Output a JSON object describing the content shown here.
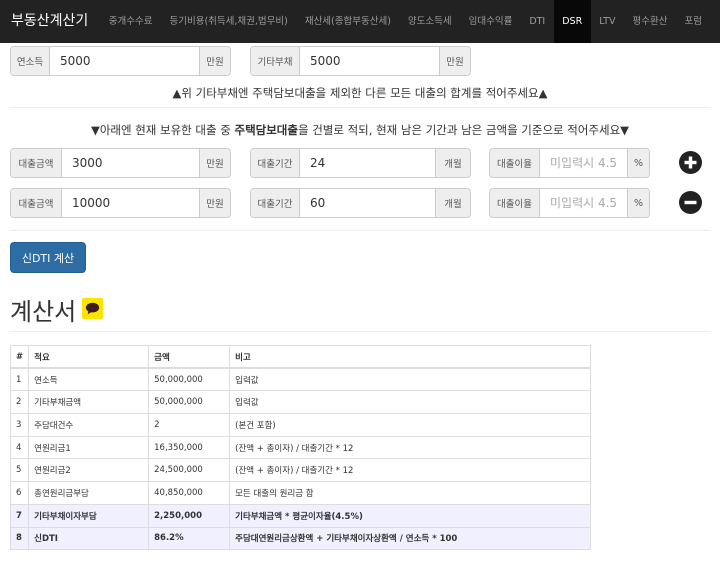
{
  "nav": {
    "brand": "부동산계산기",
    "items": [
      {
        "label": "중개수수료",
        "active": false
      },
      {
        "label": "등기비용(취득세,채권,법무비)",
        "active": false
      },
      {
        "label": "재산세(종합부동산세)",
        "active": false
      },
      {
        "label": "양도소득세",
        "active": false
      },
      {
        "label": "임대수익률",
        "active": false
      },
      {
        "label": "DTI",
        "active": false
      },
      {
        "label": "DSR",
        "active": true
      },
      {
        "label": "LTV",
        "active": false
      },
      {
        "label": "평수환산",
        "active": false
      },
      {
        "label": "포럼",
        "active": false
      }
    ]
  },
  "income": {
    "label": "연소득",
    "value": "5000",
    "unit": "만원"
  },
  "other_debt": {
    "label": "기타부채",
    "value": "5000",
    "unit": "만원"
  },
  "notice1": "▲위 기타부채엔 주택담보대출을 제외한 다른 모든 대출의 합계를 적어주세요▲",
  "notice2": {
    "before": "▼아래엔 현재 보유한 대출 중 ",
    "bold": "주택담보대출",
    "after": "을 건별로 적되, 현재 남은 기간과 남은 금액을 기준으로 적어주세요▼"
  },
  "loans": [
    {
      "amount_label": "대출금액",
      "amount": "3000",
      "amount_unit": "만원",
      "period_label": "대출기간",
      "period": "24",
      "period_unit": "개월",
      "rate_label": "대출이율",
      "rate_value": "",
      "rate_placeholder": "미입력시 4.5",
      "rate_unit": "%",
      "action": "add"
    },
    {
      "amount_label": "대출금액",
      "amount": "10000",
      "amount_unit": "만원",
      "period_label": "대출기간",
      "period": "60",
      "period_unit": "개월",
      "rate_label": "대출이율",
      "rate_value": "",
      "rate_placeholder": "미입력시 4.5",
      "rate_unit": "%",
      "action": "remove"
    }
  ],
  "calc_button": "신DTI 계산",
  "result_title": "계산서",
  "icons": {
    "add": "plus-circle-icon",
    "remove": "minus-circle-icon",
    "talk": "kakaotalk-icon"
  },
  "colors": {
    "navbar": "#222222",
    "active_nav": "#080808",
    "primary": "#337ab7",
    "highlight_row": "#f0f0ff",
    "talk_icon": "#ffe400"
  },
  "table": {
    "headers": [
      "#",
      "적요",
      "금액",
      "비고"
    ],
    "rows": [
      {
        "no": "1",
        "item": "연소득",
        "amount": "50,000,000",
        "note": "입력값",
        "highlight": false
      },
      {
        "no": "2",
        "item": "기타부채금액",
        "amount": "50,000,000",
        "note": "입력값",
        "highlight": false
      },
      {
        "no": "3",
        "item": "주담대건수",
        "amount": "2",
        "note": "(본건 포함)",
        "highlight": false
      },
      {
        "no": "4",
        "item": "연원리금1",
        "amount": "16,350,000",
        "note": "(잔액 + 총이자) / 대출기간 * 12",
        "highlight": false
      },
      {
        "no": "5",
        "item": "연원리금2",
        "amount": "24,500,000",
        "note": "(잔액 + 총이자) / 대출기간 * 12",
        "highlight": false
      },
      {
        "no": "6",
        "item": "총연원리금부담",
        "amount": "40,850,000",
        "note": "모든 대출의 원리금 합",
        "highlight": false
      },
      {
        "no": "7",
        "item": "기타부채이자부담",
        "amount": "2,250,000",
        "note": "기타부채금액 * 평균이자율(4.5%)",
        "highlight": true
      },
      {
        "no": "8",
        "item": "신DTI",
        "amount": "86.2%",
        "note": "주담대연원리금상환액 + 기타부채이자상환액 / 연소득 * 100",
        "highlight": true
      }
    ]
  }
}
